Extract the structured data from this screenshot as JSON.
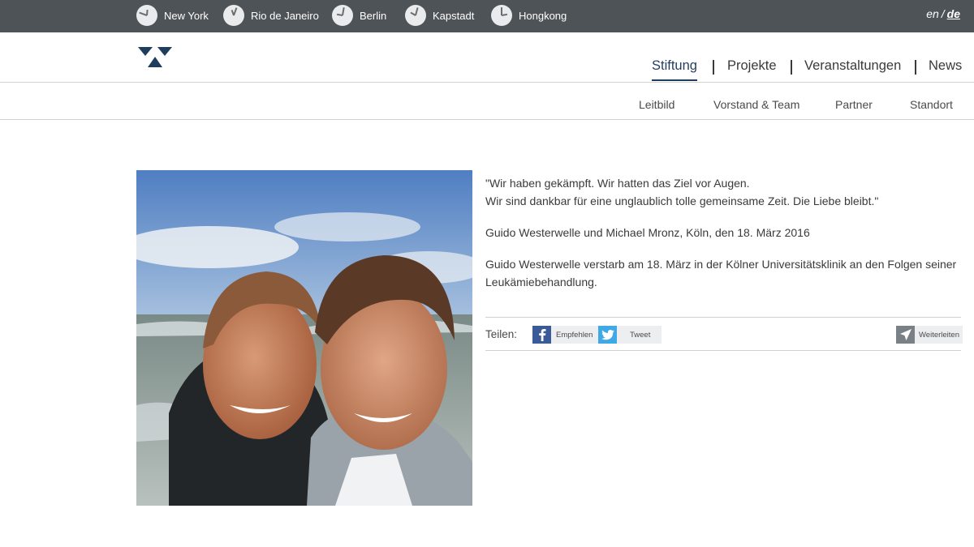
{
  "topbar": {
    "cities": [
      {
        "name": "New York",
        "hour_deg": 185,
        "minute_deg": 110
      },
      {
        "name": "Rio de Janeiro",
        "hour_deg": 160,
        "minute_deg": 200
      },
      {
        "name": "Berlin",
        "hour_deg": 100,
        "minute_deg": 190
      },
      {
        "name": "Kapstadt",
        "hour_deg": 120,
        "minute_deg": 195
      },
      {
        "name": "Hongkong",
        "hour_deg": 260,
        "minute_deg": 180
      }
    ],
    "lang": {
      "en": "en",
      "sep": "/",
      "de": "de",
      "active": "de"
    }
  },
  "logo": {
    "icon": "triangles-logo-icon",
    "color": "#1f3e5e"
  },
  "mainnav": {
    "items": [
      "Stiftung",
      "Projekte",
      "Veranstaltungen",
      "News"
    ],
    "active": "Stiftung"
  },
  "subnav": {
    "items": [
      "Leitbild",
      "Vorstand & Team",
      "Partner",
      "Standort"
    ]
  },
  "photo": {
    "icon": "portrait-photo"
  },
  "content": {
    "quote_line1": "\"Wir haben gekämpft. Wir hatten das Ziel vor Augen.",
    "quote_line2": "Wir sind dankbar für eine unglaublich tolle gemeinsame Zeit. Die Liebe bleibt.\"",
    "attribution": "Guido Westerwelle und Michael Mronz, Köln, den 18. März 2016",
    "notice": "Guido Westerwelle verstarb am 18. März in der Kölner Universitätsklinik an den Folgen seiner Leukämiebehandlung."
  },
  "share": {
    "label": "Teilen:",
    "facebook": "Empfehlen",
    "twitter": "Tweet",
    "forward": "Weiterleiten",
    "colors": {
      "facebook": "#3b5b98",
      "twitter": "#3fa8e6",
      "forward": "#7a8186"
    }
  }
}
